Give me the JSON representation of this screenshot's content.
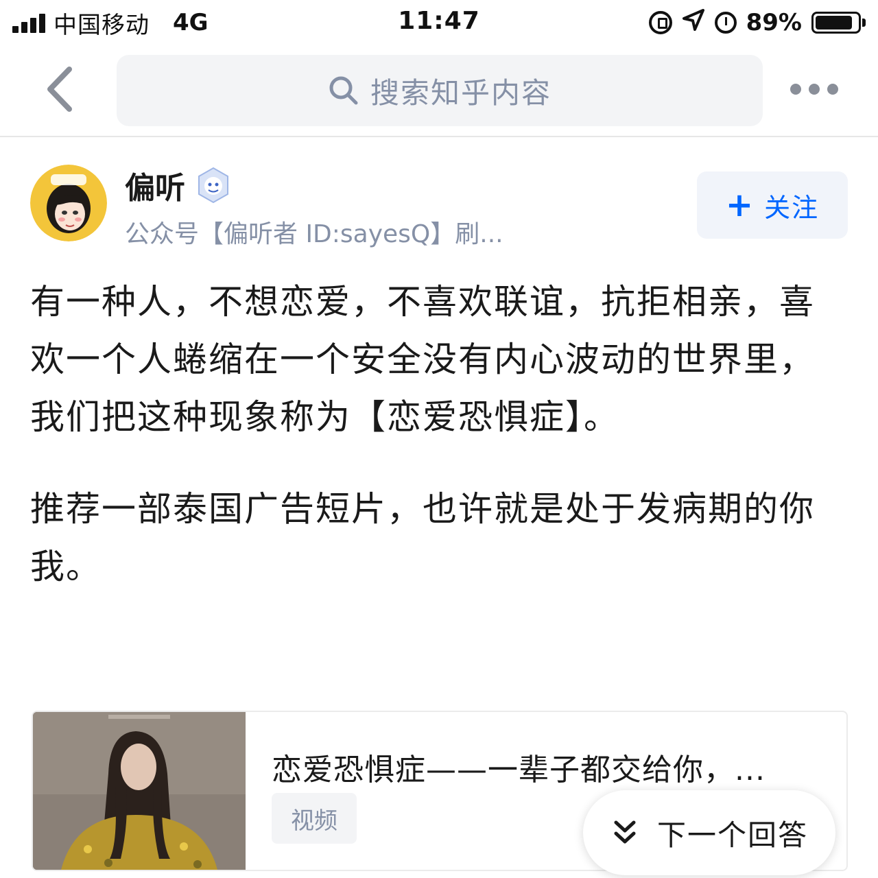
{
  "status_bar": {
    "carrier": "中国移动",
    "network": "4G",
    "time": "11:47",
    "battery_percent": "89%",
    "battery_level": 0.89
  },
  "navbar": {
    "search_placeholder": "搜索知乎内容"
  },
  "author": {
    "name": "偏听",
    "bio": "公众号【偏听者 ID:sayesQ】刷...",
    "follow_label": "关注",
    "follow_color": "#0066ff"
  },
  "content": {
    "paragraphs": [
      "有一种人，不想恋爱，不喜欢联谊，抗拒相亲，喜欢一个人蜷缩在一个安全没有内心波动的世界里，我们把这种现象称为【恋爱恐惧症】。",
      "推荐一部泰国广告短片，也许就是处于发病期的你我。"
    ]
  },
  "video_card": {
    "title": "恋爱恐惧症——一辈子都交给你，...",
    "tag": "视频"
  },
  "next_answer": {
    "label": "下一个回答"
  }
}
